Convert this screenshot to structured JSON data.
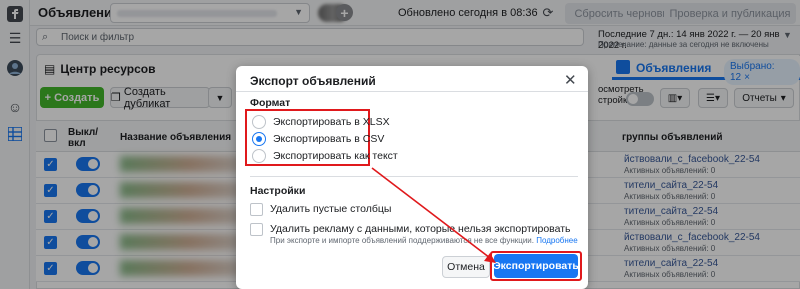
{
  "topbar": {
    "title": "Объявления",
    "updated_text": "Обновлено сегодня в 08:36",
    "reset_drafts": "Сбросить черновики",
    "review_publish": "Проверка и публикация"
  },
  "search": {
    "placeholder": "Поиск и фильтр"
  },
  "date": {
    "range": "Последние 7 дн.: 14 янв 2022 г. — 20 янв 2022 г.",
    "note": "Примечание: данные за сегодня не включены"
  },
  "tabs": {
    "resources": "Центр ресурсов",
    "ads": "Объявления",
    "selected": "Выбрано: 12"
  },
  "toolbar": {
    "create": "Создать",
    "duplicate": "Создать дубликат",
    "preview_line1": "осмотреть",
    "preview_line2": "стройки",
    "reports": "Отчеты"
  },
  "table": {
    "col_onoff": "Выкл/вкл",
    "col_name": "Название объявления",
    "col_group": "группы объявлений",
    "rows": [
      {
        "group": "йствовали_c_facebook_22-54",
        "status": "Активных объявлений: 0"
      },
      {
        "group": "тители_сайта_22-54",
        "status": "Активных объявлений: 0"
      },
      {
        "group": "тители_сайта_22-54",
        "status": "Активных объявлений: 0"
      },
      {
        "group": "йствовали_c_facebook_22-54",
        "status": "Активных объявлений: 0"
      },
      {
        "group": "тители_сайта_22-54",
        "status": "Активных объявлений: 0"
      }
    ]
  },
  "dialog": {
    "title": "Экспорт объявлений",
    "format_label": "Формат",
    "options": [
      {
        "label": "Экспортировать в XLSX",
        "selected": false
      },
      {
        "label": "Экспортировать в CSV",
        "selected": true
      },
      {
        "label": "Экспортировать как текст",
        "selected": false
      }
    ],
    "settings_label": "Настройки",
    "remove_empty": "Удалить пустые столбцы",
    "remove_unexportable": "Удалить рекламу с данными, которые нельзя экспортировать",
    "hint": "При экспорте и импорте объявлений поддерживаются не все функции.",
    "hint_link": "Подробнее",
    "cancel": "Отмена",
    "export": "Экспортировать"
  },
  "colors": {
    "accent": "#1877f2",
    "create_green": "#42b72a",
    "annotation_red": "#e0191c"
  }
}
